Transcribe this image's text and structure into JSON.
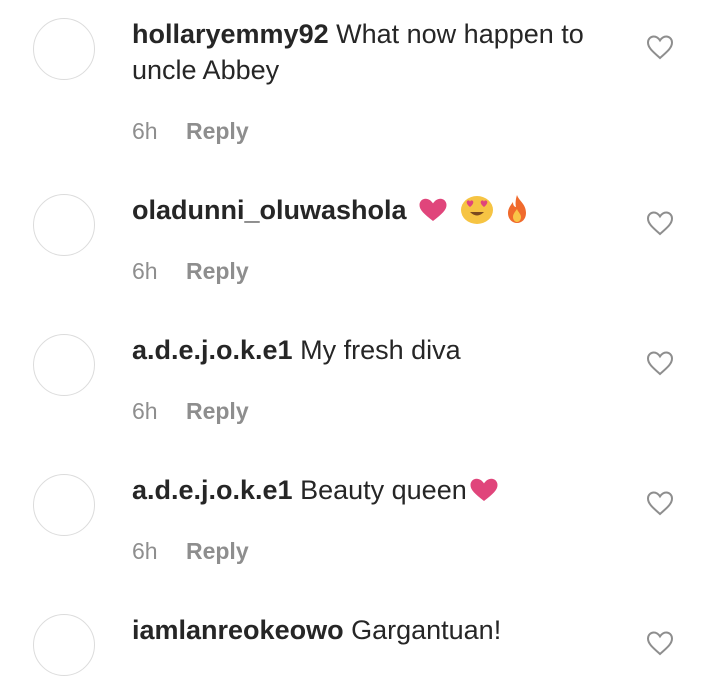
{
  "comments": [
    {
      "username": "hollaryemmy92",
      "text": "What now happen to uncle Abbey",
      "time": "6h",
      "reply": "Reply"
    },
    {
      "username": "oladunni_oluwashola",
      "text": "",
      "emojis": [
        "heart-emoji",
        "heart-eyes-emoji",
        "fire-emoji"
      ],
      "time": "6h",
      "reply": "Reply"
    },
    {
      "username": "a.d.e.j.o.k.e1",
      "text": "My fresh diva",
      "time": "6h",
      "reply": "Reply"
    },
    {
      "username": "a.d.e.j.o.k.e1",
      "text": "Beauty queen",
      "emojis": [
        "heart-emoji"
      ],
      "time": "6h",
      "reply": "Reply"
    },
    {
      "username": "iamlanreokeowo",
      "text": "Gargantuan!"
    }
  ],
  "colors": {
    "username": "#262626",
    "meta": "#8e8e8e",
    "heart_emoji": "#e0457b",
    "avatar_border": "#dcdcdc"
  }
}
